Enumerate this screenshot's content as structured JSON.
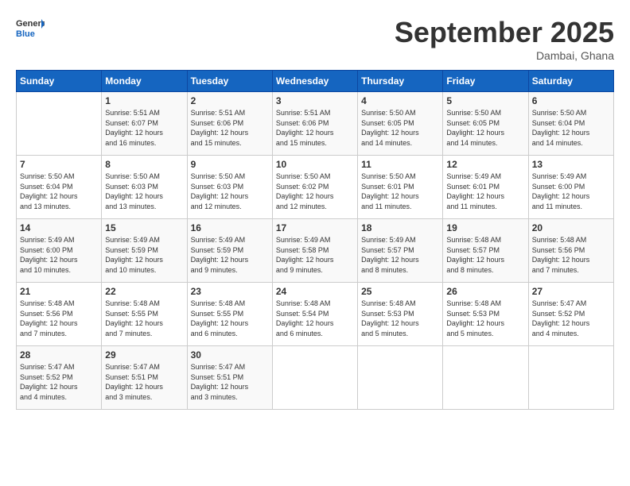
{
  "header": {
    "logo_line1": "General",
    "logo_line2": "Blue",
    "month": "September 2025",
    "location": "Dambai, Ghana"
  },
  "weekdays": [
    "Sunday",
    "Monday",
    "Tuesday",
    "Wednesday",
    "Thursday",
    "Friday",
    "Saturday"
  ],
  "weeks": [
    [
      {
        "day": "",
        "info": ""
      },
      {
        "day": "1",
        "info": "Sunrise: 5:51 AM\nSunset: 6:07 PM\nDaylight: 12 hours\nand 16 minutes."
      },
      {
        "day": "2",
        "info": "Sunrise: 5:51 AM\nSunset: 6:06 PM\nDaylight: 12 hours\nand 15 minutes."
      },
      {
        "day": "3",
        "info": "Sunrise: 5:51 AM\nSunset: 6:06 PM\nDaylight: 12 hours\nand 15 minutes."
      },
      {
        "day": "4",
        "info": "Sunrise: 5:50 AM\nSunset: 6:05 PM\nDaylight: 12 hours\nand 14 minutes."
      },
      {
        "day": "5",
        "info": "Sunrise: 5:50 AM\nSunset: 6:05 PM\nDaylight: 12 hours\nand 14 minutes."
      },
      {
        "day": "6",
        "info": "Sunrise: 5:50 AM\nSunset: 6:04 PM\nDaylight: 12 hours\nand 14 minutes."
      }
    ],
    [
      {
        "day": "7",
        "info": "Sunrise: 5:50 AM\nSunset: 6:04 PM\nDaylight: 12 hours\nand 13 minutes."
      },
      {
        "day": "8",
        "info": "Sunrise: 5:50 AM\nSunset: 6:03 PM\nDaylight: 12 hours\nand 13 minutes."
      },
      {
        "day": "9",
        "info": "Sunrise: 5:50 AM\nSunset: 6:03 PM\nDaylight: 12 hours\nand 12 minutes."
      },
      {
        "day": "10",
        "info": "Sunrise: 5:50 AM\nSunset: 6:02 PM\nDaylight: 12 hours\nand 12 minutes."
      },
      {
        "day": "11",
        "info": "Sunrise: 5:50 AM\nSunset: 6:01 PM\nDaylight: 12 hours\nand 11 minutes."
      },
      {
        "day": "12",
        "info": "Sunrise: 5:49 AM\nSunset: 6:01 PM\nDaylight: 12 hours\nand 11 minutes."
      },
      {
        "day": "13",
        "info": "Sunrise: 5:49 AM\nSunset: 6:00 PM\nDaylight: 12 hours\nand 11 minutes."
      }
    ],
    [
      {
        "day": "14",
        "info": "Sunrise: 5:49 AM\nSunset: 6:00 PM\nDaylight: 12 hours\nand 10 minutes."
      },
      {
        "day": "15",
        "info": "Sunrise: 5:49 AM\nSunset: 5:59 PM\nDaylight: 12 hours\nand 10 minutes."
      },
      {
        "day": "16",
        "info": "Sunrise: 5:49 AM\nSunset: 5:59 PM\nDaylight: 12 hours\nand 9 minutes."
      },
      {
        "day": "17",
        "info": "Sunrise: 5:49 AM\nSunset: 5:58 PM\nDaylight: 12 hours\nand 9 minutes."
      },
      {
        "day": "18",
        "info": "Sunrise: 5:49 AM\nSunset: 5:57 PM\nDaylight: 12 hours\nand 8 minutes."
      },
      {
        "day": "19",
        "info": "Sunrise: 5:48 AM\nSunset: 5:57 PM\nDaylight: 12 hours\nand 8 minutes."
      },
      {
        "day": "20",
        "info": "Sunrise: 5:48 AM\nSunset: 5:56 PM\nDaylight: 12 hours\nand 7 minutes."
      }
    ],
    [
      {
        "day": "21",
        "info": "Sunrise: 5:48 AM\nSunset: 5:56 PM\nDaylight: 12 hours\nand 7 minutes."
      },
      {
        "day": "22",
        "info": "Sunrise: 5:48 AM\nSunset: 5:55 PM\nDaylight: 12 hours\nand 7 minutes."
      },
      {
        "day": "23",
        "info": "Sunrise: 5:48 AM\nSunset: 5:55 PM\nDaylight: 12 hours\nand 6 minutes."
      },
      {
        "day": "24",
        "info": "Sunrise: 5:48 AM\nSunset: 5:54 PM\nDaylight: 12 hours\nand 6 minutes."
      },
      {
        "day": "25",
        "info": "Sunrise: 5:48 AM\nSunset: 5:53 PM\nDaylight: 12 hours\nand 5 minutes."
      },
      {
        "day": "26",
        "info": "Sunrise: 5:48 AM\nSunset: 5:53 PM\nDaylight: 12 hours\nand 5 minutes."
      },
      {
        "day": "27",
        "info": "Sunrise: 5:47 AM\nSunset: 5:52 PM\nDaylight: 12 hours\nand 4 minutes."
      }
    ],
    [
      {
        "day": "28",
        "info": "Sunrise: 5:47 AM\nSunset: 5:52 PM\nDaylight: 12 hours\nand 4 minutes."
      },
      {
        "day": "29",
        "info": "Sunrise: 5:47 AM\nSunset: 5:51 PM\nDaylight: 12 hours\nand 3 minutes."
      },
      {
        "day": "30",
        "info": "Sunrise: 5:47 AM\nSunset: 5:51 PM\nDaylight: 12 hours\nand 3 minutes."
      },
      {
        "day": "",
        "info": ""
      },
      {
        "day": "",
        "info": ""
      },
      {
        "day": "",
        "info": ""
      },
      {
        "day": "",
        "info": ""
      }
    ]
  ]
}
